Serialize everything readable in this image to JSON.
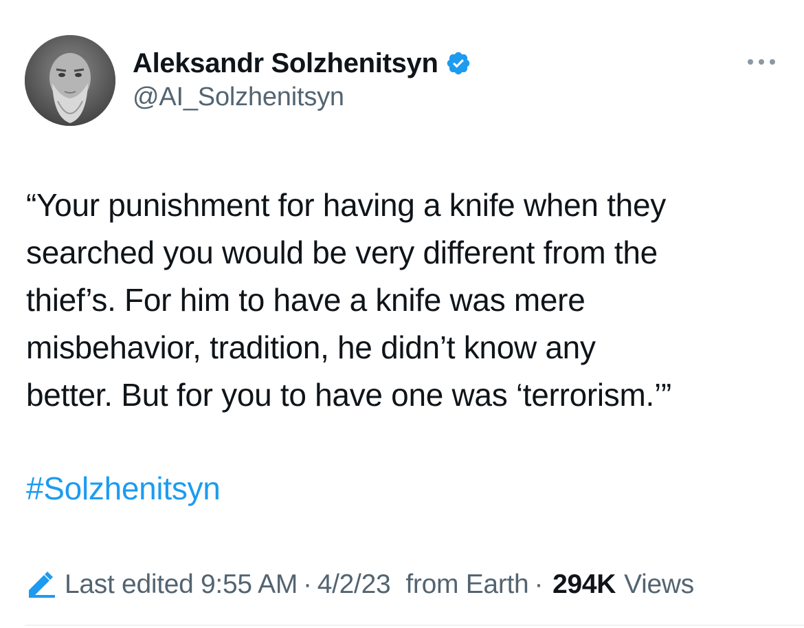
{
  "author": {
    "display_name": "Aleksandr Solzhenitsyn",
    "handle": "@AI_Solzhenitsyn",
    "verified": true
  },
  "tweet": {
    "lines": [
      "“Your punishment for having a knife when they",
      "searched you would be very different from the",
      "thief’s. For him to have a knife was mere",
      "misbehavior, tradition, he didn’t know any",
      "better. But for you to have one was ‘terrorism.’”"
    ],
    "hashtag": "#Solzhenitsyn"
  },
  "meta": {
    "edited_label": "Last edited 9:55 AM",
    "separator": "·",
    "date": "4/2/23",
    "location": "from Earth",
    "views_count": "294K",
    "views_label": "Views"
  },
  "icons": {
    "verified": "verified-badge-icon",
    "more": "more-options-icon",
    "edit": "edit-pencil-icon"
  },
  "colors": {
    "accent": "#1d9bf0",
    "text_primary": "#0f1419",
    "text_secondary": "#536471"
  }
}
